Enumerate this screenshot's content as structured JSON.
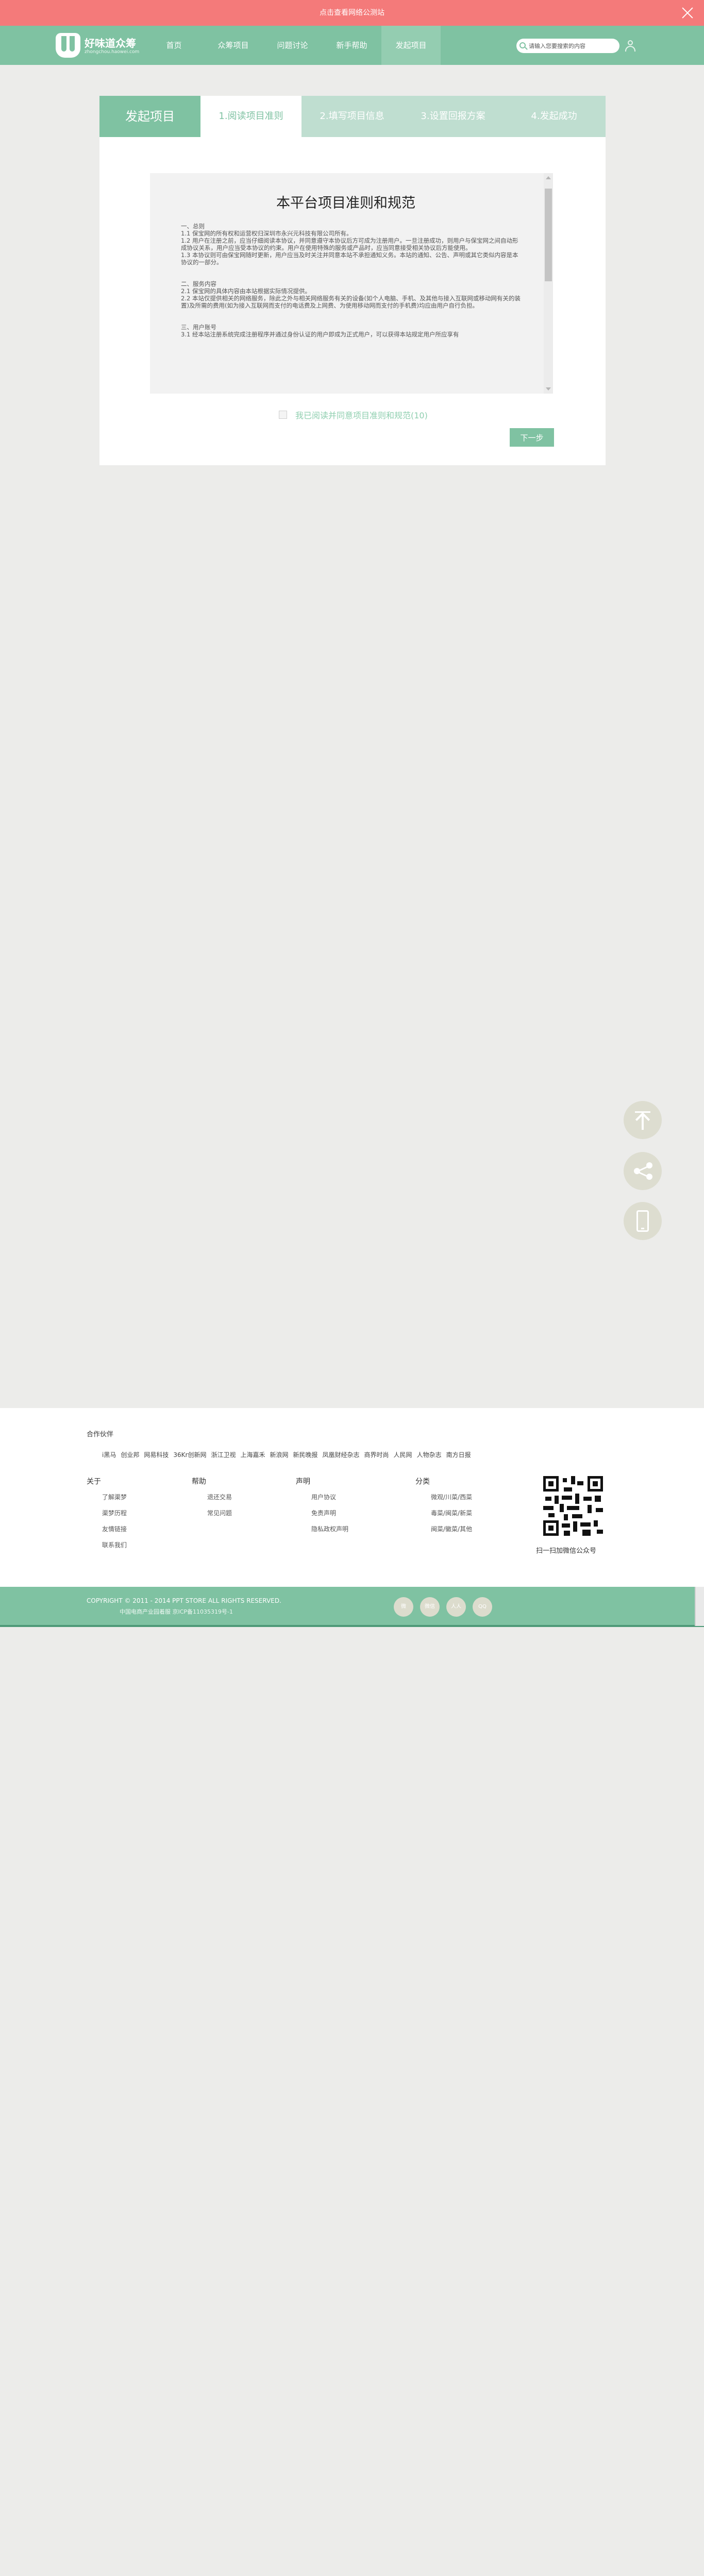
{
  "banner": {
    "text": "点击查看网络公测站",
    "close_icon": "close-icon"
  },
  "nav": {
    "logo_title": "好味道众筹",
    "logo_subtitle": "zhongchou.haowei.com",
    "items": [
      {
        "label": "首页"
      },
      {
        "label": "众筹项目"
      },
      {
        "label": "问题讨论"
      },
      {
        "label": "新手帮助"
      },
      {
        "label": "发起项目",
        "active": true
      }
    ],
    "search_placeholder": "请输入您要搜索的内容"
  },
  "steps": {
    "lead": "发起项目",
    "items": [
      {
        "label": "1.阅读项目准则",
        "active": true
      },
      {
        "label": "2.填写项目信息"
      },
      {
        "label": "3.设置回报方案"
      },
      {
        "label": "4.发起成功"
      }
    ]
  },
  "terms": {
    "title": "本平台项目准则和规范",
    "paragraphs": [
      "一、总则",
      "1.1 保宝网的所有权和运营权归深圳市永兴元科技有限公司所有。",
      "1.2 用户在注册之前，应当仔细阅读本协议，并同意遵守本协议后方可成为注册用户。一旦注册成功，则用户与保宝网之间自动形成协议关系，用户应当受本协议的约束。用户在使用特殊的服务或产品时，应当同意接受相关协议后方能使用。",
      "1.3 本协议则可由保宝网随时更新，用户应当及时关注并同意本站不承担通知义务。本站的通知、公告、声明或其它类似内容是本协议的一部分。",
      "",
      "二、服务内容",
      "2.1 保宝网的具体内容由本站根据实际情况提供。",
      "2.2 本站仅提供相关的网络服务，除此之外与相关网络服务有关的设备(如个人电脑、手机、及其他与接入互联网或移动网有关的装置)及所需的费用(如为接入互联网而支付的电话费及上网费、为使用移动网而支付的手机费)均应由用户自行负担。",
      "",
      "三、用户账号",
      "3.1 经本站注册系统完成注册程序并通过身份认证的用户即成为正式用户，可以获得本站规定用户所应享有"
    ]
  },
  "agree": {
    "label": "我已阅读并同意项目准则和规范(10)"
  },
  "next_button": "下一步",
  "float": {
    "top_icon": "arrow-up-icon",
    "share_icon": "share-icon",
    "mobile_icon": "mobile-icon"
  },
  "footer": {
    "partners_title": "合作伙伴",
    "partners": [
      "i黑马",
      "创业邦",
      "网易科技",
      "36Kr创新网",
      "浙江卫视",
      "上海嘉禾",
      "新浪网",
      "新民晚报",
      "凤凰财经杂志",
      "商界时尚",
      "人民网",
      "人物杂志",
      "南方日报"
    ],
    "columns": [
      {
        "head": "关于",
        "links": [
          "了解渠梦",
          "渠梦历程",
          "友情链接",
          "联系我们"
        ]
      },
      {
        "head": "帮助",
        "links": [
          "退还交易",
          "常见问题"
        ]
      },
      {
        "head": "声明",
        "links": [
          "用户协议",
          "免责声明",
          "隐私政权声明"
        ]
      },
      {
        "head": "分类",
        "links": [
          "微观/川菜/西菜",
          "毒菜/闽菜/新菜",
          "闽菜/徽菜/其他"
        ]
      }
    ],
    "qr_caption": "扫一扫加微信公众号",
    "copyright": "COPYRIGHT © 2011 - 2014 PPT STORE ALL RIGHTS RESERVED.",
    "icp": "中国电商产业园着服    京ICP备11035319号-1",
    "social": [
      "微",
      "微信",
      "人人",
      "QQ"
    ]
  }
}
